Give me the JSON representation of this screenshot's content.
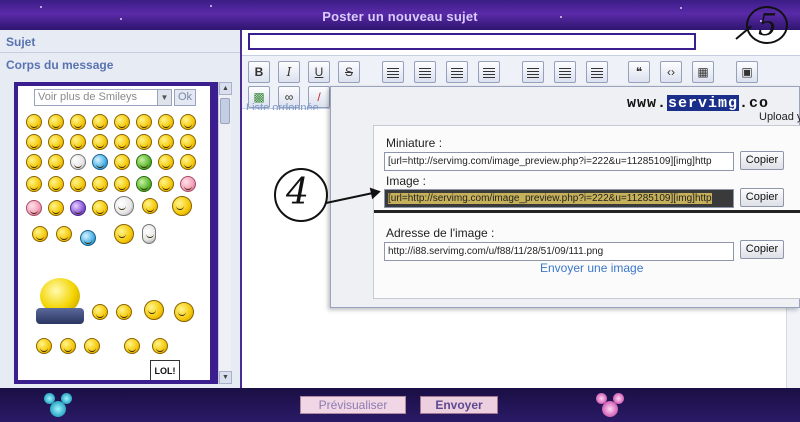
{
  "header": {
    "title": "Poster un nouveau sujet"
  },
  "left": {
    "subject_label": "Sujet",
    "body_label": "Corps du message",
    "smiley_select": "Voir plus de Smileys",
    "ok_label": "Ok",
    "lol_sign": "LOL!"
  },
  "editor": {
    "list_hint": "Liste ordonnée"
  },
  "annotations": {
    "step_5": "5",
    "step_4": "4"
  },
  "servimg": {
    "logo_prefix": "www.",
    "logo_main": "servimg",
    "logo_suffix": ".co",
    "tagline": "Upload your",
    "miniature_label": "Miniature :",
    "miniature_value": "[url=http://servimg.com/image_preview.php?i=222&u=11285109][img]http",
    "image_label": "Image :",
    "image_value": "[url=http://servimg.com/image_preview.php?i=222&u=11285109][img]http",
    "address_label": "Adresse de l'image :",
    "address_value": "http://i88.servimg.com/u/f88/11/28/51/09/111.png",
    "copy_label": "Copier",
    "send_image_link": "Envoyer une image"
  },
  "footer": {
    "preview_label": "Prévisualiser",
    "send_label": "Envoyer"
  }
}
